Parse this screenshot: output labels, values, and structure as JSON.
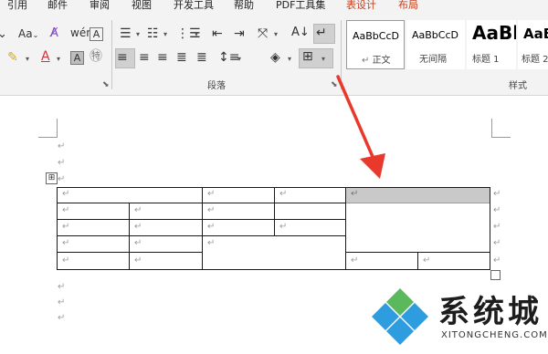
{
  "ribbon": {
    "tabs": [
      {
        "label": "引用"
      },
      {
        "label": "邮件"
      },
      {
        "label": "审阅"
      },
      {
        "label": "视图"
      },
      {
        "label": "开发工具"
      },
      {
        "label": "帮助"
      },
      {
        "label": "PDF工具集"
      },
      {
        "label": "表设计",
        "active": true
      },
      {
        "label": "布局",
        "active": true
      }
    ],
    "groups": {
      "paragraph": {
        "label": "段落"
      },
      "styles": {
        "label": "样式"
      }
    },
    "font_case_label": "Aa",
    "styles_gallery": [
      {
        "sample": "AaBbCcD",
        "name": "正文",
        "selected": true
      },
      {
        "sample": "AaBbCcD",
        "name": "无间隔"
      },
      {
        "sample": "AaBl",
        "name": "标题 1"
      },
      {
        "sample": "AaBb",
        "name": "标题 2"
      }
    ],
    "icons": [
      "font-case-icon",
      "clear-format-icon",
      "pinyin-icon",
      "char-border-icon",
      "highlight-icon",
      "font-color-icon",
      "char-shading-icon",
      "enclose-char-icon",
      "bullets-icon",
      "numbering-icon",
      "multilevel-list-icon",
      "decrease-indent-icon",
      "increase-indent-icon",
      "chinese-layout-icon",
      "sort-icon",
      "show-marks-icon",
      "align-left-icon",
      "align-center-icon",
      "align-right-icon",
      "justify-icon",
      "distributed-icon",
      "line-spacing-icon",
      "shading-icon",
      "borders-icon",
      "dialog-launcher-icon"
    ],
    "accent_color": "#c43e1c"
  },
  "document": {
    "paragraph_mark": "↵",
    "table_move_handle": "⊞",
    "table": {
      "rows": 5,
      "shaded_cell_color": "#c9c9c9"
    }
  },
  "annotation": {
    "arrow_color": "#e8392c"
  },
  "watermark": {
    "title": "系统城",
    "subtitle": "XITONGCHENG.COM",
    "logo_colors": [
      "#2d9de0",
      "#5cb85c"
    ]
  }
}
